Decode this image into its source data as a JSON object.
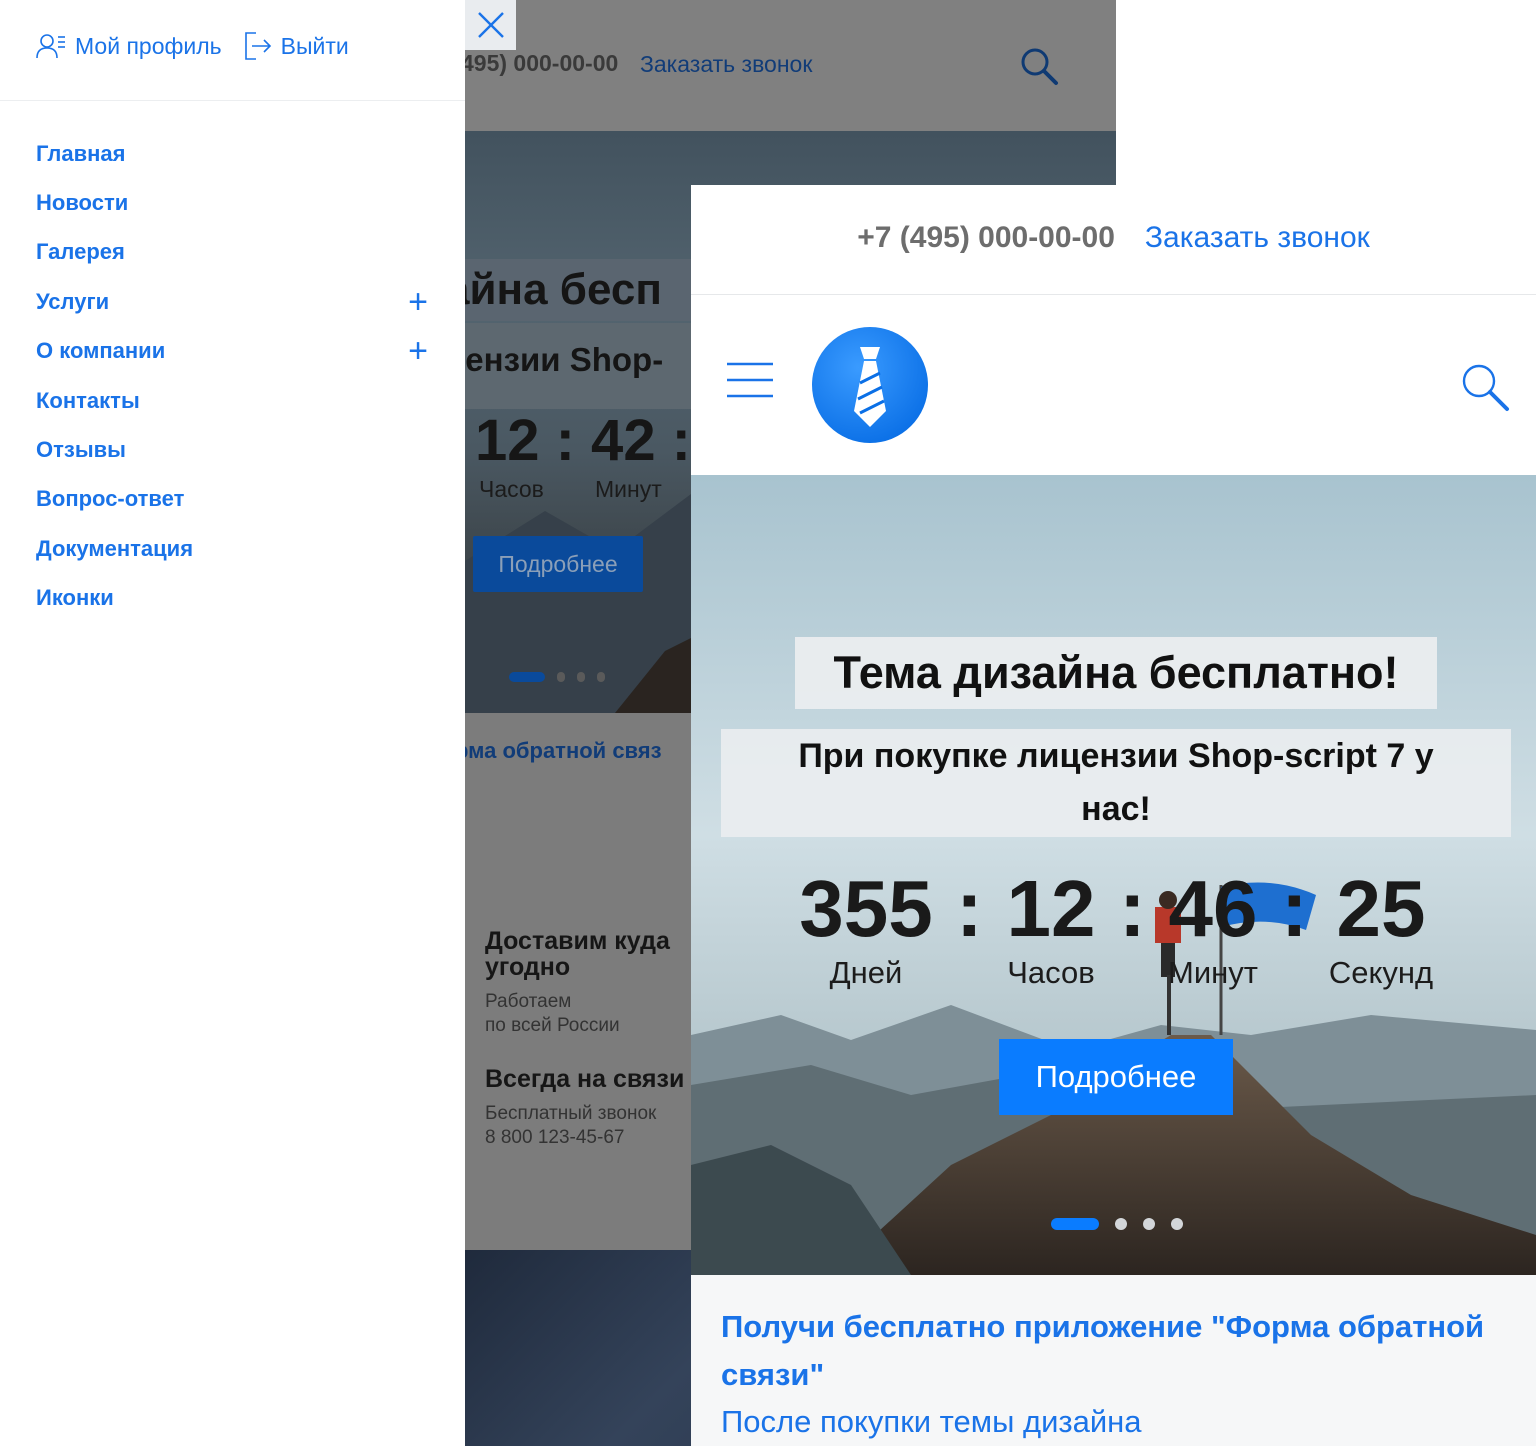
{
  "drawer": {
    "profile_label": "Мой профиль",
    "logout_label": "Выйти",
    "menu": [
      {
        "label": "Главная",
        "expandable": false
      },
      {
        "label": "Новости",
        "expandable": false
      },
      {
        "label": "Галерея",
        "expandable": false
      },
      {
        "label": "Услуги",
        "expandable": true
      },
      {
        "label": "О компании",
        "expandable": true
      },
      {
        "label": "Контакты",
        "expandable": false
      },
      {
        "label": "Отзывы",
        "expandable": false
      },
      {
        "label": "Вопрос-ответ",
        "expandable": false
      },
      {
        "label": "Документация",
        "expandable": false
      },
      {
        "label": "Иконки",
        "expandable": false
      }
    ],
    "expand_symbol": "+"
  },
  "background_page": {
    "phone_partial": "495) 000-00-00",
    "callback_label": "Заказать звонок",
    "hero_title_partial": "айна бесп",
    "hero_sub_partial": "цензии Shop-",
    "timer_partial": "12 : 42 :",
    "label_hours": "Часов",
    "label_minutes": "Минут",
    "more_label": "Подробнее",
    "link_partial": "рма обратной связ",
    "features": [
      {
        "title": "Доставим куда угодно",
        "text_line1": "Работаем",
        "text_line2": "по всей России"
      },
      {
        "title": "Всегда на связи",
        "text_line1": "Бесплатный звонок",
        "text_line2": "8 800 123-45-67"
      }
    ]
  },
  "foreground": {
    "phone": "+7 (495) 000-00-00",
    "callback_label": "Заказать звонок",
    "hero": {
      "title": "Тема дизайна бесплатно!",
      "subtitle": "При покупке лицензии Shop-script 7 у нас!",
      "countdown": {
        "days": "355",
        "hours": "12",
        "minutes": "46",
        "seconds": "25",
        "days_label": "Дней",
        "hours_label": "Часов",
        "minutes_label": "Минут",
        "seconds_label": "Секунд",
        "separator": ":"
      },
      "more_label": "Подробнее",
      "slides_count": 4,
      "active_slide": 1
    },
    "promo": {
      "title": "Получи бесплатно приложение \"Форма обратной связи\"",
      "text": "После покупки темы дизайна"
    }
  },
  "colors": {
    "accent": "#1a73e8",
    "button": "#0a7cff",
    "overlay": "#7c7c7c"
  },
  "icons": [
    "user-icon",
    "logout-icon",
    "close-icon",
    "search-icon",
    "hamburger-icon",
    "tie-logo-icon",
    "plus-icon"
  ]
}
